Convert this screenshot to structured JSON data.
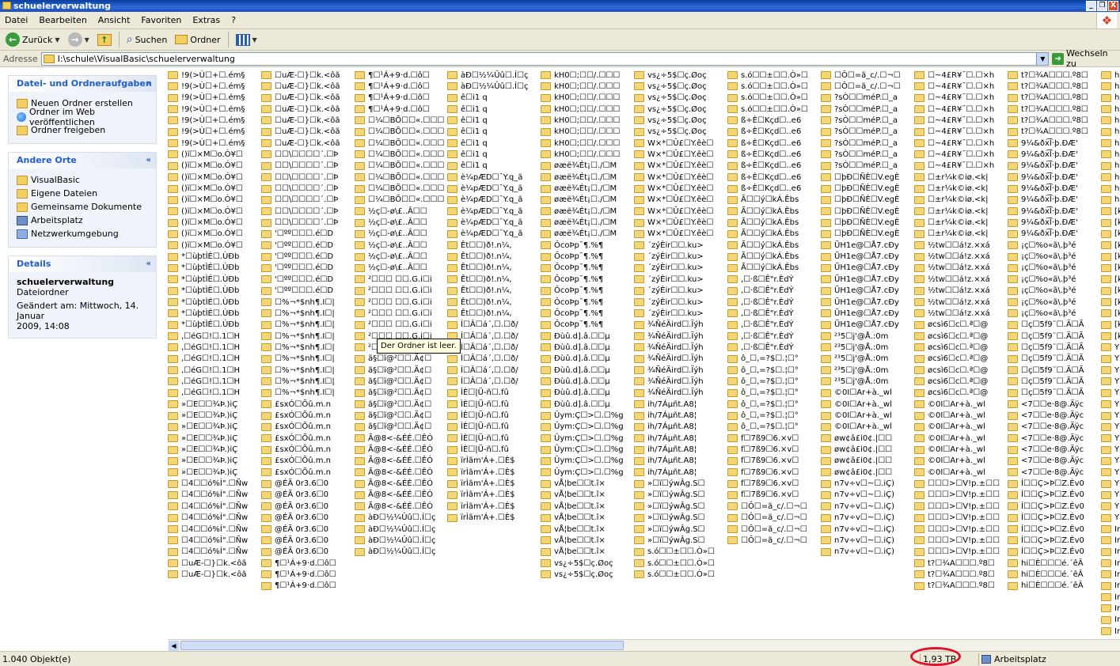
{
  "window": {
    "title": "schuelerverwaltung",
    "buttons": [
      "_",
      "❐",
      "X"
    ]
  },
  "menu": [
    "Datei",
    "Bearbeiten",
    "Ansicht",
    "Favoriten",
    "Extras",
    "?"
  ],
  "toolbar": {
    "back_label": "Zurück",
    "search_label": "Suchen",
    "folders_label": "Ordner"
  },
  "address": {
    "label": "Adresse",
    "value": "I:\\schule\\VisualBasic\\schuelerverwaltung",
    "go_label": "Wechseln zu"
  },
  "tasks": {
    "title": "Datei- und Ordneraufgaben",
    "items": [
      "Neuen Ordner erstellen",
      "Ordner im Web veröffentlichen",
      "Ordner freigeben"
    ]
  },
  "places": {
    "title": "Andere Orte",
    "items": [
      "VisualBasic",
      "Eigene Dateien",
      "Gemeinsame Dokumente",
      "Arbeitsplatz",
      "Netzwerkumgebung"
    ]
  },
  "details": {
    "title": "Details",
    "name": "schuelerverwaltung",
    "type": "Dateiordner",
    "modified_line1": "Geändert am: Mittwoch, 14. Januar",
    "modified_line2": "2009, 14:08"
  },
  "tooltip": "Der Ordner ist leer.",
  "columns": [
    [
      {
        "t": "!9(>Ù☐+☐.ém§",
        "n": 7
      },
      {
        "t": "()ï☐×M☐o.Ó¥☐",
        "n": 9
      },
      {
        "t": "*☐ùþtÌÉ☐.ÙÐb",
        "n": 7
      },
      {
        "t": ",☐éG☐!☐.1☐H",
        "n": 6
      },
      {
        "t": "»☐E☐☐¾Þ.)iÇ",
        "n": 7
      },
      {
        "t": "☐4☐☐ó%Í\".☐Ñw",
        "n": 7
      },
      {
        "t": "☐uÆ-☐}☐k.<ôã",
        "n": 2
      }
    ],
    [
      {
        "t": "☐uÆ-☐}☐k.<ôã",
        "n": 7
      },
      {
        "t": "☐☐\\☐☐☐☐´.☐Þ",
        "n": 7
      },
      {
        "t": "'☐ºº☐☐☐.é☐D",
        "n": 6
      },
      {
        "t": "☐%¬*$nh¶.I☐|",
        "n": 9
      },
      {
        "t": "£sxÓ☐Õû.m.n",
        "n": 7
      },
      {
        "t": "@ÉÃ 0r3.6☐0",
        "n": 7
      },
      {
        "t": "¶☐¹Á+9·d.☐ô☐",
        "n": 3
      }
    ],
    [
      {
        "t": "¶☐¹Á+9·d.☐ô☐",
        "n": 4
      },
      {
        "t": "☐¼☐BÕ☐☐«.☐☐☐",
        "n": 8
      },
      {
        "t": "½ç☐-ø\\£..Â☐☐",
        "n": 6
      },
      {
        "t": "²☐☐☐ ☐☐.G.i☐i",
        "n": 7
      },
      {
        "t": "ã§☐ï@²☐☐.Ä¢☐",
        "n": 7
      },
      {
        "t": "Ã@8<-&ÉÉ.☐ÊÓ",
        "n": 7
      },
      {
        "t": "àÐ☐½¼Ûû☐.Í☐ç",
        "n": 4
      }
    ],
    [
      {
        "t": "àÐ☐½¼Ûû☐.Í☐ç",
        "n": 2
      },
      {
        "t": "ê☐i1 q",
        "n": 7
      },
      {
        "t": "è¼pÆD☐¯Y.q_ã",
        "n": 6
      },
      {
        "t": "Êt☐☐)ð!.n¼,",
        "n": 7
      },
      {
        "t": "Í☐Â☐á´,☐.☐ð/",
        "n": 6
      },
      {
        "t": "ÌÈ☐|Ü-ñ☐.fû",
        "n": 6
      },
      {
        "t": "ïrÌãm'Á+.☐È$",
        "n": 6
      }
    ],
    [
      {
        "t": "kH0☐;☐☐/.☐☐☐",
        "n": 8
      },
      {
        "t": "øæë¾Ét¡☐./☐M",
        "n": 7
      },
      {
        "t": "ÔcoÞp¯¶.%¶",
        "n": 8
      },
      {
        "t": "Ðùû.d].â.☐☐µ",
        "n": 7
      },
      {
        "t": "Ûym:Ç☐>☐.☐%g",
        "n": 6
      },
      {
        "t": "vÅ¦be☐☐t.î×",
        "n": 7
      },
      {
        "t": "vs¿÷5$☐ç.Øoç",
        "n": 2
      }
    ],
    [
      {
        "t": "vs¿÷5$☐ç.Øoç",
        "n": 6
      },
      {
        "t": "W×*☐Û£☐Y.êè☐",
        "n": 9
      },
      {
        "t": "´zýÈir☐☐.ku>",
        "n": 7
      },
      {
        "t": "¾ÑéÄird☐.Ïýh",
        "n": 7
      },
      {
        "t": "ih/7Áµñt.A8¦",
        "n": 7
      },
      {
        "t": "»☐ï☐ýwÂg.S☐",
        "n": 6
      },
      {
        "t": "s.ó☐☐±☐☐.Ò»☐",
        "n": 3
      }
    ],
    [
      {
        "t": "s.ó☐☐±☐☐.Ò»☐",
        "n": 4
      },
      {
        "t": "ß÷È☐Kçd☐..e6",
        "n": 7
      },
      {
        "t": "Ã☐☐ý☐kÁ.Êbs",
        "n": 7
      },
      {
        "t": ",☐·ß☐Ê\"r.ÈdÝ",
        "n": 7
      },
      {
        "t": "ô_☐,=?$☐.¦☐°",
        "n": 7
      },
      {
        "t": "f☐7ß9☐6.×v☐",
        "n": 6
      },
      {
        "t": "☐Ô☐=ã_c/.☐¬☐",
        "n": 4
      }
    ],
    [
      {
        "t": "☐Ô☐=ã_c/.☐¬☐",
        "n": 2
      },
      {
        "t": "?sÒ☐☐méP.☐_a",
        "n": 7
      },
      {
        "t": "☐þÐ☐ÑÈ☐V.egÈ",
        "n": 6
      },
      {
        "t": "ÜH1e@☐Å7.cÐy",
        "n": 8
      },
      {
        "t": "²³5☐j'@Å.:0m",
        "n": 5
      },
      {
        "t": "©0I☐Ar+à._wl",
        "n": 4
      },
      {
        "t": "øw¢â£i0¢.|☐☐",
        "n": 4
      },
      {
        "t": "n7v÷v☐~☐.iÇ)",
        "n": 7
      }
    ],
    [
      {
        "t": "☐~4£R¥¯☐.☐×h",
        "n": 9
      },
      {
        "t": "☐±r¼k©iø.<k|",
        "n": 6
      },
      {
        "t": "½tw☐☐á!z.×xá",
        "n": 7
      },
      {
        "t": "øcsì6☐c☐.ª☐@",
        "n": 7
      },
      {
        "t": "©0I☐Ar+à._wl",
        "n": 7
      },
      {
        "t": "☐☐☐>☐V!p.±☐☐",
        "n": 7
      },
      {
        "t": "t?☐¾A☐☐☐.º8☐",
        "n": 3
      }
    ],
    [
      {
        "t": "t?☐¾A☐☐☐.º8☐",
        "n": 6
      },
      {
        "t": "9¼&ðx͡Í·þ.ÐÆ'",
        "n": 9
      },
      {
        "t": "¡ç☐%o«ã\\.þ³é",
        "n": 7
      },
      {
        "t": "☐ç☐5f9¨☐.Ä☐Ã",
        "n": 7
      },
      {
        "t": "<7☐☐e·8@.Äÿc",
        "n": 7
      },
      {
        "t": "Í☐☐Ç>Þ☐Z.Év0",
        "n": 7
      },
      {
        "t": "hi☐È☐☐☐é.´êÂ",
        "n": 3
      }
    ],
    [
      {
        "t": "hi",
        "n": 12
      },
      {
        "t": "[k",
        "n": 12
      },
      {
        "t": "Y",
        "n": 16
      },
      {
        "t": "Ir",
        "n": 10
      }
    ]
  ],
  "status": {
    "count": "1.040 Objekt(e)",
    "size": "1,93 TB",
    "zone": "Arbeitsplatz"
  }
}
